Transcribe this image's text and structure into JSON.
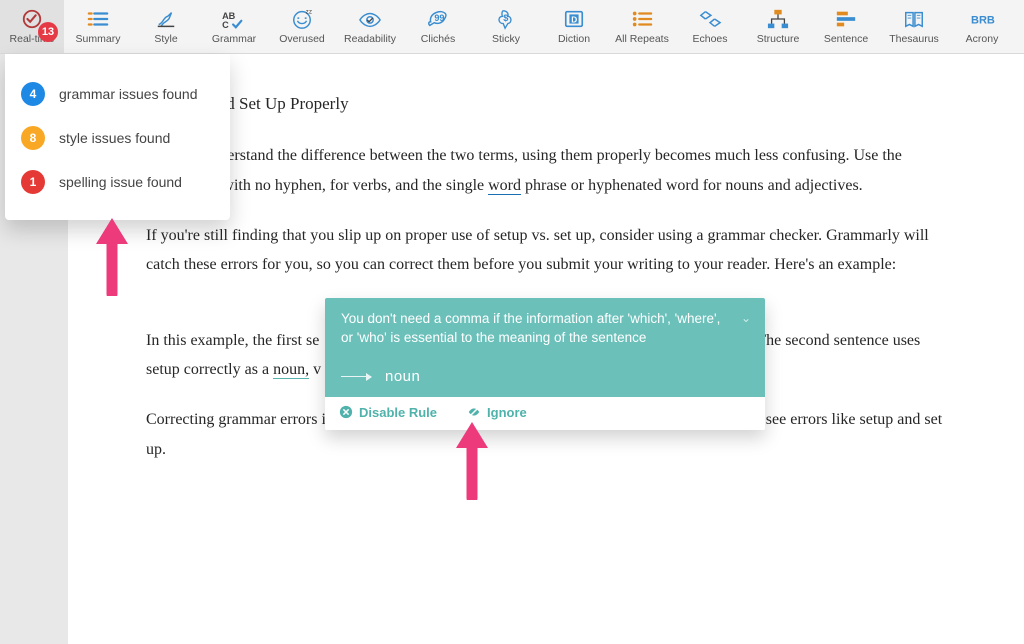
{
  "toolbar": {
    "badge": "13",
    "items": [
      {
        "label": "Real-time"
      },
      {
        "label": "Summary"
      },
      {
        "label": "Style"
      },
      {
        "label": "Grammar"
      },
      {
        "label": "Overused"
      },
      {
        "label": "Readability"
      },
      {
        "label": "Clichés"
      },
      {
        "label": "Sticky"
      },
      {
        "label": "Diction"
      },
      {
        "label": "All Repeats"
      },
      {
        "label": "Echoes"
      },
      {
        "label": "Structure"
      },
      {
        "label": "Sentence"
      },
      {
        "label": "Thesaurus"
      },
      {
        "label": "Acrony"
      }
    ]
  },
  "dropdown": {
    "rows": [
      {
        "count": "4",
        "label": "grammar issues found"
      },
      {
        "count": "8",
        "label": "style issues found"
      },
      {
        "count": "1",
        "label": "spelling issue found"
      }
    ]
  },
  "doc": {
    "heading_partial": "Setup and Set Up Properly",
    "p1a": " understand the difference between the two terms, using them properly becomes much less confusing. Use the ",
    "p1b": "rase, with no hyphen, for verbs, and the single ",
    "p1_word": "word",
    "p1c": " phrase or hyphenated word for nouns and adjectives.",
    "p2": "If you're still finding that you slip up on proper use of setup vs. set up, consider using a grammar checker. Grammarly will catch these errors for you, so you can correct them before you submit your writing to your reader. Here's an example:",
    "p3a": "In this example, the first se",
    "p3b": "rrect. The second sentence uses setup correctly as a ",
    "p3_noun": "noun,",
    "p3c": " v",
    "p4": "Correcting grammar errors is one way to make yourself a better writer. Grammarly can help you see errors like setup and set up."
  },
  "suggestion": {
    "message": "You don't need a comma if the information after 'which', 'where', or 'who' is essential to the meaning of the sentence",
    "replacement": "noun",
    "disable": "Disable Rule",
    "ignore": "Ignore"
  }
}
